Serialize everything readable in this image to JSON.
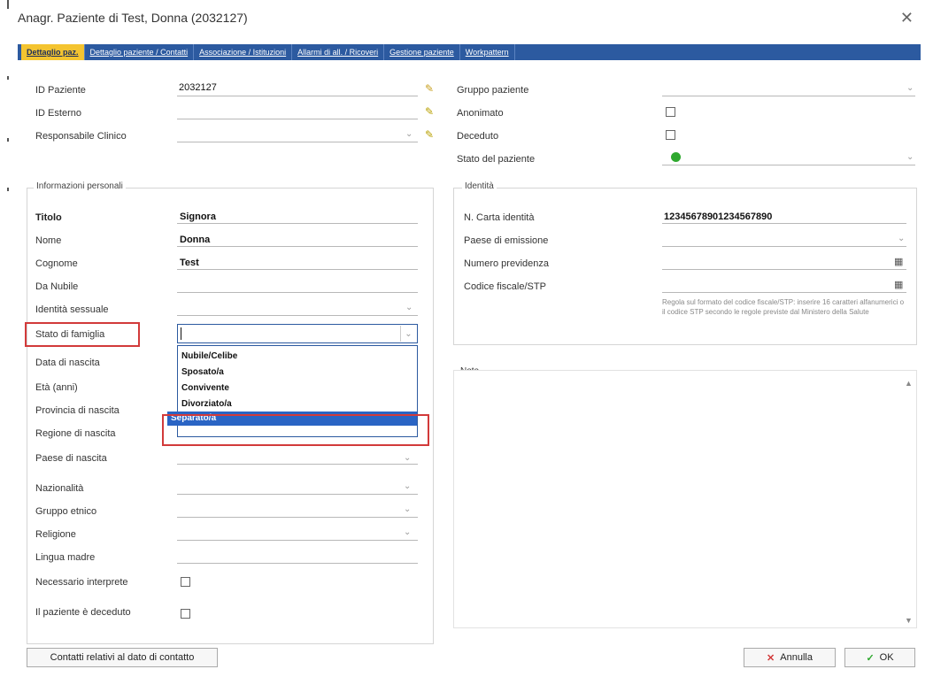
{
  "window": {
    "title": "Anagr. Paziente di Test, Donna (2032127)",
    "close": "✕"
  },
  "tabs": [
    "Dettaglio paz.",
    "Dettaglio paziente / Contatti",
    "Associazione / Istituzioni",
    "Allarmi di all. / Ricoveri",
    "Gestione paziente",
    "Workpattern"
  ],
  "top_left": {
    "id_paziente_label": "ID Paziente",
    "id_paziente_value": "2032127",
    "id_esterno_label": "ID Esterno",
    "responsabile_label": "Responsabile Clinico"
  },
  "top_right": {
    "gruppo_label": "Gruppo paziente",
    "anonimo_label": "Anonimato",
    "defunto_label": "Deceduto",
    "stato_label": "Stato del paziente"
  },
  "personal": {
    "title": "Informazioni personali",
    "fields": [
      {
        "label": "Titolo",
        "value": "Signora"
      },
      {
        "label": "Nome",
        "value": "Donna"
      },
      {
        "label": "Cognome",
        "value": "Test"
      },
      {
        "label": "Da Nubile",
        "value": ""
      },
      {
        "label": "Identità sessuale",
        "value": ""
      },
      {
        "label": "Stato di famiglia",
        "value": ""
      },
      {
        "label": "Data di nascita",
        "value": ""
      },
      {
        "label": "Età (anni)",
        "value": ""
      },
      {
        "label": "Provincia di nascita",
        "value": ""
      },
      {
        "label": "Regione di nascita",
        "value": ""
      },
      {
        "label": "Paese di nascita",
        "value": ""
      },
      {
        "label": "Nazionalità",
        "value": ""
      },
      {
        "label": "Gruppo etnico",
        "value": ""
      },
      {
        "label": "Religione",
        "value": ""
      },
      {
        "label": "Lingua madre",
        "value": ""
      },
      {
        "label": "Necessario interprete",
        "value": ""
      },
      {
        "label": "Il paziente è deceduto",
        "value": ""
      }
    ]
  },
  "dropdown": {
    "options": [
      "Nubile/Celibe",
      "Sposato/a",
      "Convivente",
      "Divorziato/a",
      "Separato/a"
    ],
    "selected_index": 4
  },
  "identity": {
    "title": "Identità",
    "carta_label": "N. Carta identità",
    "carta_value": "12345678901234567890",
    "paese_label": "Paese di emissione",
    "previdenza_label": "Numero previdenza",
    "codice_label": "Codice fiscale/STP",
    "hint": "Regola sul formato del codice fiscale/STP: inserire 16 caratteri alfanumerici o il codice STP secondo le regole previste dal Ministero della Salute"
  },
  "notes": {
    "title": "Note"
  },
  "footer": {
    "contatti_button": "Contatti relativi al dato di contatto",
    "annulla_button": "Annulla",
    "ok_button": "OK"
  },
  "icons": {
    "pen": "✎",
    "chev": "⌄",
    "grid": "▦",
    "scroll_up": "▲",
    "scroll_down": "▼",
    "cancel": "✕",
    "check": "✓"
  },
  "colors": {
    "tabbar": "#2c5aa0",
    "active_tab": "#f4c430",
    "highlight": "#d23a3a",
    "selection": "#2a64c4",
    "status_green": "#2ea82e"
  }
}
